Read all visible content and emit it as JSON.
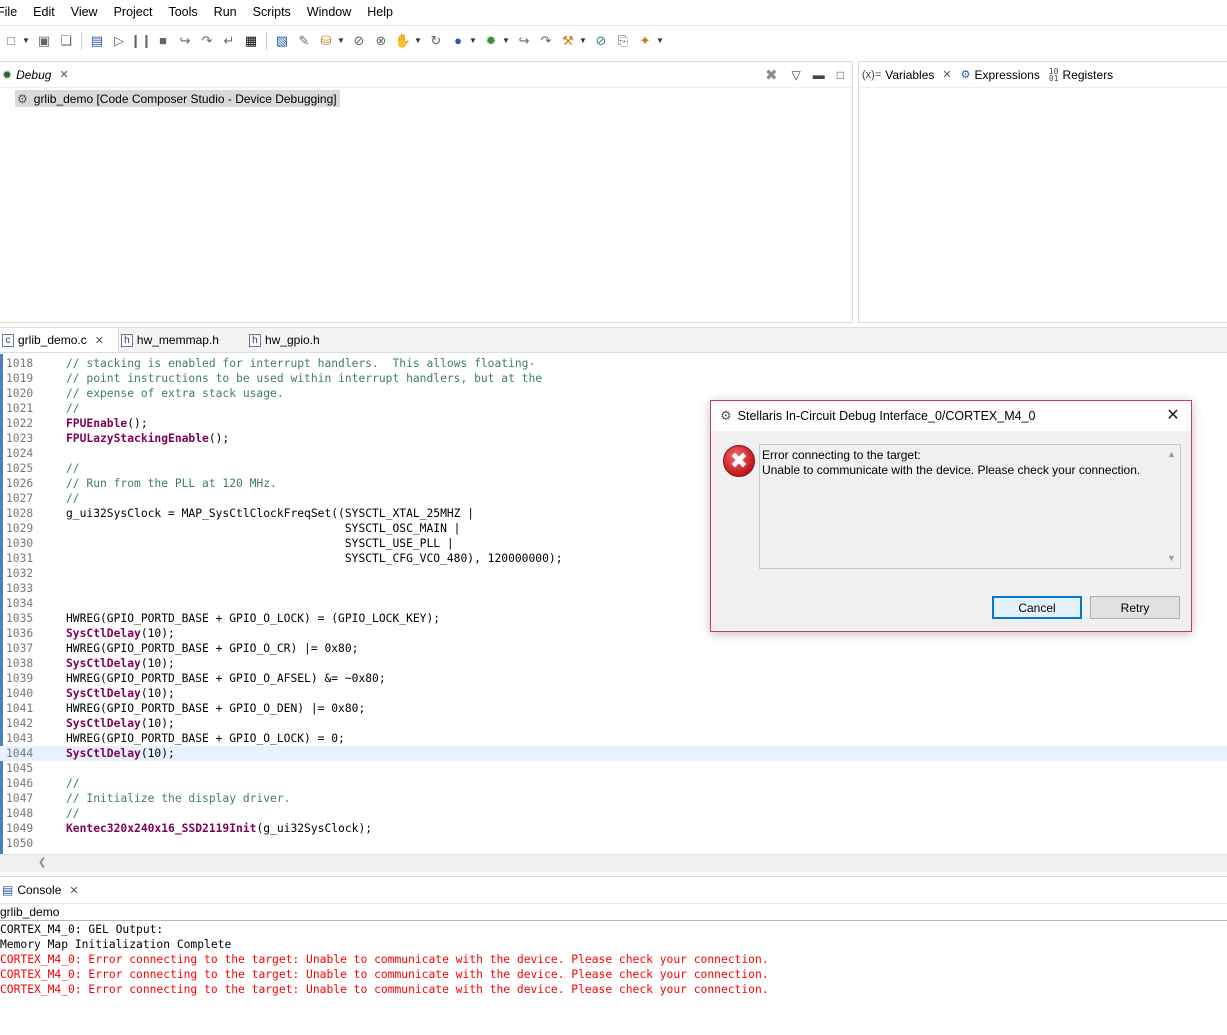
{
  "menu": [
    "File",
    "Edit",
    "View",
    "Project",
    "Tools",
    "Run",
    "Scripts",
    "Window",
    "Help"
  ],
  "debug_view": {
    "tab_label": "Debug",
    "session": "grlib_demo [Code Composer Studio - Device Debugging]"
  },
  "vars_view": {
    "tabs": [
      {
        "label": "Variables",
        "icon": "(x)="
      },
      {
        "label": "Expressions",
        "icon": "expressions-icon"
      },
      {
        "label": "Registers",
        "icon": "registers-icon"
      }
    ]
  },
  "editor": {
    "tabs": [
      {
        "label": "grlib_demo.c"
      },
      {
        "label": "hw_memmap.h"
      },
      {
        "label": "hw_gpio.h"
      }
    ],
    "lines": [
      {
        "n": "1018",
        "kind": "cm",
        "text": "// stacking is enabled for interrupt handlers.  This allows floating-"
      },
      {
        "n": "1019",
        "kind": "cm",
        "text": "// point instructions to be used within interrupt handlers, but at the"
      },
      {
        "n": "1020",
        "kind": "cm",
        "text": "// expense of extra stack usage."
      },
      {
        "n": "1021",
        "kind": "cm",
        "text": "//"
      },
      {
        "n": "1022",
        "kind": "fn",
        "fn": "FPUEnable",
        "rest": "();"
      },
      {
        "n": "1023",
        "kind": "fn",
        "fn": "FPULazyStackingEnable",
        "rest": "();"
      },
      {
        "n": "1024",
        "kind": "plain",
        "text": ""
      },
      {
        "n": "1025",
        "kind": "cm",
        "text": "//"
      },
      {
        "n": "1026",
        "kind": "cm",
        "text": "// Run from the PLL at 120 MHz."
      },
      {
        "n": "1027",
        "kind": "cm",
        "text": "//"
      },
      {
        "n": "1028",
        "kind": "plain",
        "text": "g_ui32SysClock = MAP_SysCtlClockFreqSet((SYSCTL_XTAL_25MHZ |"
      },
      {
        "n": "1029",
        "kind": "plain",
        "text": "                                         SYSCTL_OSC_MAIN |"
      },
      {
        "n": "1030",
        "kind": "plain",
        "text": "                                         SYSCTL_USE_PLL |"
      },
      {
        "n": "1031",
        "kind": "plain",
        "text": "                                         SYSCTL_CFG_VCO_480), 120000000);"
      },
      {
        "n": "1032",
        "kind": "plain",
        "text": ""
      },
      {
        "n": "1033",
        "kind": "plain",
        "text": ""
      },
      {
        "n": "1034",
        "kind": "plain",
        "text": ""
      },
      {
        "n": "1035",
        "kind": "plain",
        "text": "HWREG(GPIO_PORTD_BASE + GPIO_O_LOCK) = (GPIO_LOCK_KEY);"
      },
      {
        "n": "1036",
        "kind": "fn",
        "fn": "SysCtlDelay",
        "rest": "(10);"
      },
      {
        "n": "1037",
        "kind": "plain",
        "text": "HWREG(GPIO_PORTD_BASE + GPIO_O_CR) |= 0x80;"
      },
      {
        "n": "1038",
        "kind": "fn",
        "fn": "SysCtlDelay",
        "rest": "(10);"
      },
      {
        "n": "1039",
        "kind": "plain",
        "text": "HWREG(GPIO_PORTD_BASE + GPIO_O_AFSEL) &= ~0x80;"
      },
      {
        "n": "1040",
        "kind": "fn",
        "fn": "SysCtlDelay",
        "rest": "(10);"
      },
      {
        "n": "1041",
        "kind": "plain",
        "text": "HWREG(GPIO_PORTD_BASE + GPIO_O_DEN) |= 0x80;"
      },
      {
        "n": "1042",
        "kind": "fn",
        "fn": "SysCtlDelay",
        "rest": "(10);"
      },
      {
        "n": "1043",
        "kind": "plain",
        "text": "HWREG(GPIO_PORTD_BASE + GPIO_O_LOCK) = 0;"
      },
      {
        "n": "1044",
        "kind": "fn",
        "fn": "SysCtlDelay",
        "rest": "(10);",
        "current": true
      },
      {
        "n": "1045",
        "kind": "plain",
        "text": ""
      },
      {
        "n": "1046",
        "kind": "cm",
        "text": "//"
      },
      {
        "n": "1047",
        "kind": "cm",
        "text": "// Initialize the display driver."
      },
      {
        "n": "1048",
        "kind": "cm",
        "text": "//"
      },
      {
        "n": "1049",
        "kind": "fn",
        "fn": "Kentec320x240x16_SSD2119Init",
        "rest": "(g_ui32SysClock);"
      },
      {
        "n": "1050",
        "kind": "plain",
        "text": ""
      }
    ]
  },
  "console": {
    "tab_label": "Console",
    "name": "grlib_demo",
    "lines": [
      {
        "text": "CORTEX_M4_0: GEL Output:",
        "err": false
      },
      {
        "text": "Memory Map Initialization Complete",
        "err": false
      },
      {
        "text": "CORTEX_M4_0: Error connecting to the target: Unable to communicate with the device. Please check your connection.",
        "err": true
      },
      {
        "text": "CORTEX_M4_0: Error connecting to the target: Unable to communicate with the device. Please check your connection.",
        "err": true
      },
      {
        "text": "CORTEX_M4_0: Error connecting to the target: Unable to communicate with the device. Please check your connection.",
        "err": true
      }
    ]
  },
  "dialog": {
    "title": "Stellaris In-Circuit Debug Interface_0/CORTEX_M4_0",
    "message_line1": "Error connecting to the target:",
    "message_line2": "Unable to communicate with the device. Please check your connection.",
    "cancel_label": "Cancel",
    "retry_label": "Retry"
  }
}
